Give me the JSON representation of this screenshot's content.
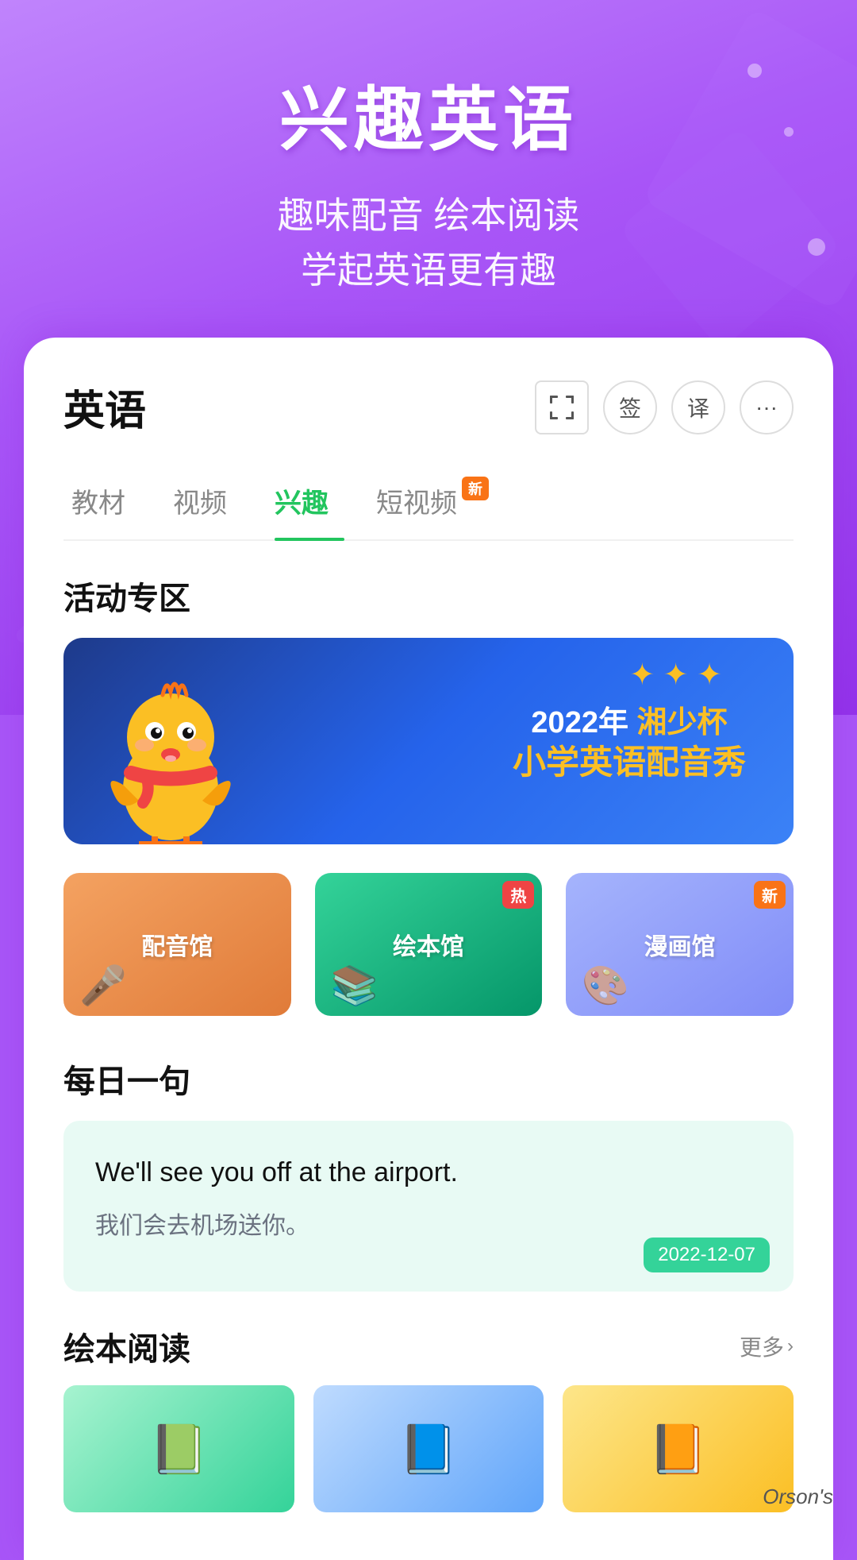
{
  "app": {
    "background_color": "#a855f7"
  },
  "hero": {
    "title": "兴趣英语",
    "subtitle_line1": "趣味配音 绘本阅读",
    "subtitle_line2": "学起英语更有趣"
  },
  "card": {
    "title": "英语",
    "icons": {
      "scan_label": "扫描",
      "sign_label": "签",
      "translate_label": "译",
      "more_label": "更多"
    },
    "tabs": [
      {
        "label": "教材",
        "active": false,
        "badge": ""
      },
      {
        "label": "视频",
        "active": false,
        "badge": ""
      },
      {
        "label": "兴趣",
        "active": true,
        "badge": ""
      },
      {
        "label": "短视频",
        "active": false,
        "badge": "新"
      }
    ],
    "activity": {
      "section_title": "活动专区",
      "banner": {
        "year": "2022年",
        "title_line1": "湘少杯",
        "title_line2": "小学英语配音秀"
      },
      "features": [
        {
          "label": "配音馆",
          "badge": "",
          "style": "dubbing",
          "icon": "🎤"
        },
        {
          "label": "绘本馆",
          "badge": "热",
          "style": "picture",
          "icon": "📖"
        },
        {
          "label": "漫画馆",
          "badge": "新",
          "style": "manga",
          "icon": "🎨"
        }
      ]
    },
    "daily": {
      "section_title": "每日一句",
      "english": "We'll see you off at the airport.",
      "chinese": "我们会去机场送你。",
      "date": "2022-12-07"
    },
    "picture_books": {
      "section_title": "绘本阅读",
      "more_label": "更多",
      "items": []
    }
  },
  "watermark": "Orson's"
}
